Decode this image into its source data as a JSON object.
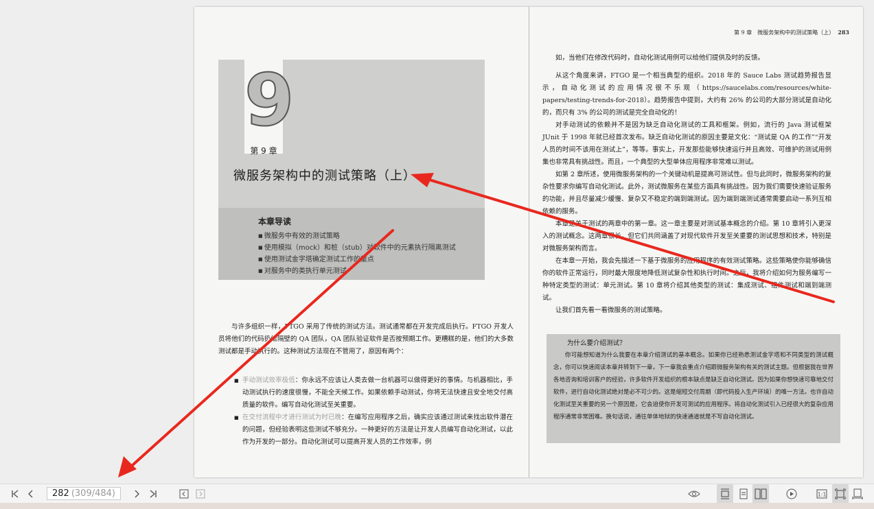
{
  "left_page": {
    "chapter_number": "9",
    "chapter_label": "第 9 章",
    "chapter_title": "微服务架构中的测试策略（上）",
    "guide_title": "本章导读",
    "guide_items": [
      "微服务中有效的测试策略",
      "使用模拟（mock）和桩（stub）对软件中的元素执行隔离测试",
      "使用测试金字塔确定测试工作的重点",
      "对服务中的类执行单元测试"
    ],
    "intro": "与许多组织一样，FTGO 采用了传统的测试方法。测试通常都在开发完成后执行。FTGO 开发人员将他们的代码扔给隔壁的 QA 团队，QA 团队验证软件是否按预期工作。更糟糕的是，他们的大多数测试都是手动执行的。这种测试方法现在不管用了，原因有两个：",
    "bullets": [
      {
        "lead": "手动测试效率极低",
        "text": "：你永远不应该让人类去做一台机器可以做得更好的事情。与机器相比，手动测试执行的速度很慢，不能全天候工作。如果依赖手动测试，你将无法快速且安全地交付高质量的软件。编写自动化测试至关重要。"
      },
      {
        "lead": "在交付流程中才进行测试为时已晚",
        "text": "：在编写应用程序之后，确实应该通过测试来找出软件潜在的问题，但经验表明这些测试不够充分。一种更好的方法是让开发人员编写自动化测试，以此作为开发的一部分。自动化测试可以提高开发人员的工作效率，例"
      }
    ]
  },
  "right_page": {
    "running_head": "第 9 章　微服务架构中的测试策略（上）",
    "page_number": "283",
    "paragraphs": [
      "如，当他们在修改代码时，自动化测试用例可以给他们提供及时的反馈。",
      "从这个角度来讲，FTGO 是一个相当典型的组织。2018 年的 Sauce Labs 测试趋势报告显示，自动化测试的应用情况很不乐观（https://saucelabs.com/resources/white-papers/testing-trends-for-2018）。趋势报告中提到，大约有 26% 的公司的大部分测试是自动化的，而只有 3% 的公司的测试是完全自动化的！",
      "对手动测试的依赖并不是因为缺乏自动化测试的工具和框架。例如，流行的 Java 测试框架 JUnit 于 1998 年就已经首次发布。缺乏自动化测试的原因主要是文化：“测试是 QA 的工作”“开发人员的时间不该用在测试上”，等等。事实上，开发那些能够快速运行并且高效、可维护的测试用例集也非常具有挑战性。而且，一个典型的大型单体应用程序非常难以测试。",
      "如第 2 章所述，使用微服务架构的一个关键动机是提高可测试性。但与此同时，微服务架构的复杂性要求你编写自动化测试。此外，测试微服务在某些方面具有挑战性。因为我们需要快速验证服务的功能，并且尽量减少缓慢、复杂又不稳定的端到端测试。因为端到端测试通常需要启动一系列互相依赖的服务。",
      "本章是关于测试的两章中的第一章。这一章主要是对测试基本概念的介绍。第 10 章将引入更深入的测试概念。这两章很长，但它们共同涵盖了对现代软件开发至关重要的测试思想和技术，特别是对微服务架构而言。",
      "在本章一开始，我会先描述一下基于微服务的应用程序的有效测试策略。这些策略使你能够确信你的软件正常运行，同时最大限度地降低测试复杂性和执行时间。之后，我将介绍如何为服务编写一种特定类型的测试：单元测试。第 10 章将介绍其他类型的测试：集成测试、组件测试和端到端测试。",
      "让我们首先看一看微服务的测试策略。"
    ],
    "sidebar_title": "为什么要介绍测试？",
    "sidebar_text": "你可能想知道为什么我要在本章介绍测试的基本概念。如果你已经熟悉测试金字塔和不同类型的测试概念，你可以快速阅读本章并转到下一章，下一章我会重点介绍跟微服务架构有关的测试主题。但根据我在世界各地咨询和培训客户的经验，许多软件开发组织的根本缺点是缺乏自动化测试。因为如果你想快速可靠地交付软件，进行自动化测试绝对是必不可少的。这是缩短交付周期（即代码投入生产环境）的唯一方法。也许自动化测试至关重要的另一个原因是，它会迫使你开发可测试的应用程序。将自动化测试引入已经很大的复杂应用程序通常非常困难。换句话说，通往单体地狱的快速通道就是不写自动化测试。"
  },
  "toolbar": {
    "page_current": "282",
    "page_info": "(309/484)",
    "first_icon": "first-page-icon",
    "prev_icon": "prev-page-icon",
    "next_icon": "next-page-icon",
    "last_icon": "last-page-icon"
  },
  "colors": {
    "annotation_arrow": "#e8281e",
    "page_bg": "#f6f6f4",
    "viewer_bg": "#eeeeef"
  }
}
